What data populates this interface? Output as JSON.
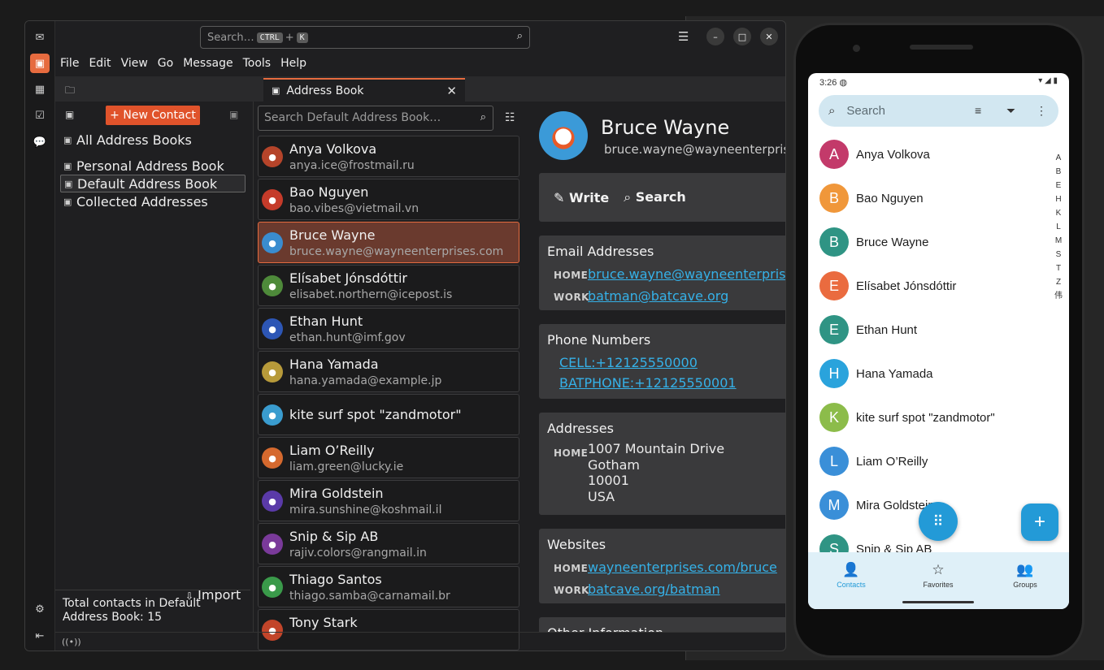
{
  "thunderbird": {
    "search_placeholder": "Search…",
    "search_key1": "CTRL",
    "search_plus": "+",
    "search_key2": "K",
    "menu": [
      "File",
      "Edit",
      "View",
      "Go",
      "Message",
      "Tools",
      "Help"
    ],
    "tab_title": "Address Book",
    "new_contact_label": "New Contact",
    "books": [
      "All Address Books",
      "Personal Address Book",
      "Default Address Book",
      "Collected Addresses"
    ],
    "import_label": "Import",
    "footer_text": "Total contacts in Default Address Book: 15",
    "list_search_placeholder": "Search Default Address Book…",
    "contacts": [
      {
        "name": "Anya Volkova",
        "email": "anya.ice@frostmail.ru",
        "color": "#b5442a"
      },
      {
        "name": "Bao Nguyen",
        "email": "bao.vibes@vietmail.vn",
        "color": "#c53b2a"
      },
      {
        "name": "Bruce Wayne",
        "email": "bruce.wayne@wayneenterprises.com",
        "color": "#3a8ccf"
      },
      {
        "name": "Elísabet Jónsdóttir",
        "email": "elisabet.northern@icepost.is",
        "color": "#4e8a3a"
      },
      {
        "name": "Ethan Hunt",
        "email": "ethan.hunt@imf.gov",
        "color": "#2d56b5"
      },
      {
        "name": "Hana Yamada",
        "email": "hana.yamada@example.jp",
        "color": "#b79a3a"
      },
      {
        "name": "kite surf spot \"zandmotor\"",
        "email": "",
        "color": "#3a9ccf"
      },
      {
        "name": "Liam O’Reilly",
        "email": "liam.green@lucky.ie",
        "color": "#d5692e"
      },
      {
        "name": "Mira Goldstein",
        "email": "mira.sunshine@koshmail.il",
        "color": "#5a3aa8"
      },
      {
        "name": "Snip & Sip AB",
        "email": "rajiv.colors@rangmail.in",
        "color": "#7a3a9a"
      },
      {
        "name": "Thiago Santos",
        "email": "thiago.samba@carnamail.br",
        "color": "#3a9a4a"
      },
      {
        "name": "Tony Stark",
        "email": "",
        "color": "#c2452a"
      }
    ],
    "selected_contact": "Bruce Wayne",
    "detail": {
      "name": "Bruce Wayne",
      "email": "bruce.wayne@wayneenterprises.com",
      "write_label": "Write",
      "search_label": "Search",
      "email_heading": "Email Addresses",
      "email_home_tag": "HOME",
      "email_home": "bruce.wayne@wayneenterprises.com",
      "email_work_tag": "WORK",
      "email_work": "batman@batcave.org",
      "phone_heading": "Phone Numbers",
      "phone_cell": "CELL:+12125550000",
      "phone_bat": "BATPHONE:+12125550001",
      "addr_heading": "Addresses",
      "addr_tag": "HOME",
      "addr_lines": [
        "1007 Mountain Drive",
        "Gotham",
        "10001",
        "USA"
      ],
      "web_heading": "Websites",
      "web_home_tag": "HOME",
      "web_home": "wayneenterprises.com/bruce",
      "web_work_tag": "WORK",
      "web_work": "batcave.org/batman",
      "other_heading": "Other Information"
    }
  },
  "phone": {
    "time": "3:26",
    "search_placeholder": "Search",
    "contacts": [
      {
        "letter": "A",
        "name": "Anya Volkova",
        "color": "#c33a6a"
      },
      {
        "letter": "B",
        "name": "Bao Nguyen",
        "color": "#f0973a"
      },
      {
        "letter": "B",
        "name": "Bruce Wayne",
        "color": "#2f9484"
      },
      {
        "letter": "E",
        "name": "Elísabet Jónsdóttir",
        "color": "#ea6b3f"
      },
      {
        "letter": "E",
        "name": "Ethan Hunt",
        "color": "#2f9484"
      },
      {
        "letter": "H",
        "name": "Hana Yamada",
        "color": "#2aa3dc"
      },
      {
        "letter": "K",
        "name": "kite surf spot \"zandmotor\"",
        "color": "#8cbc4a"
      },
      {
        "letter": "L",
        "name": "Liam O’Reilly",
        "color": "#3a8fd8"
      },
      {
        "letter": "M",
        "name": "Mira Goldstein",
        "color": "#3a8fd8"
      },
      {
        "letter": "S",
        "name": "Snip & Sip AB",
        "color": "#2f9484"
      }
    ],
    "index_letters": [
      "A",
      "B",
      "E",
      "H",
      "K",
      "L",
      "M",
      "S",
      "T",
      "Z",
      "伟"
    ],
    "nav": [
      "Contacts",
      "Favorites",
      "Groups"
    ]
  }
}
